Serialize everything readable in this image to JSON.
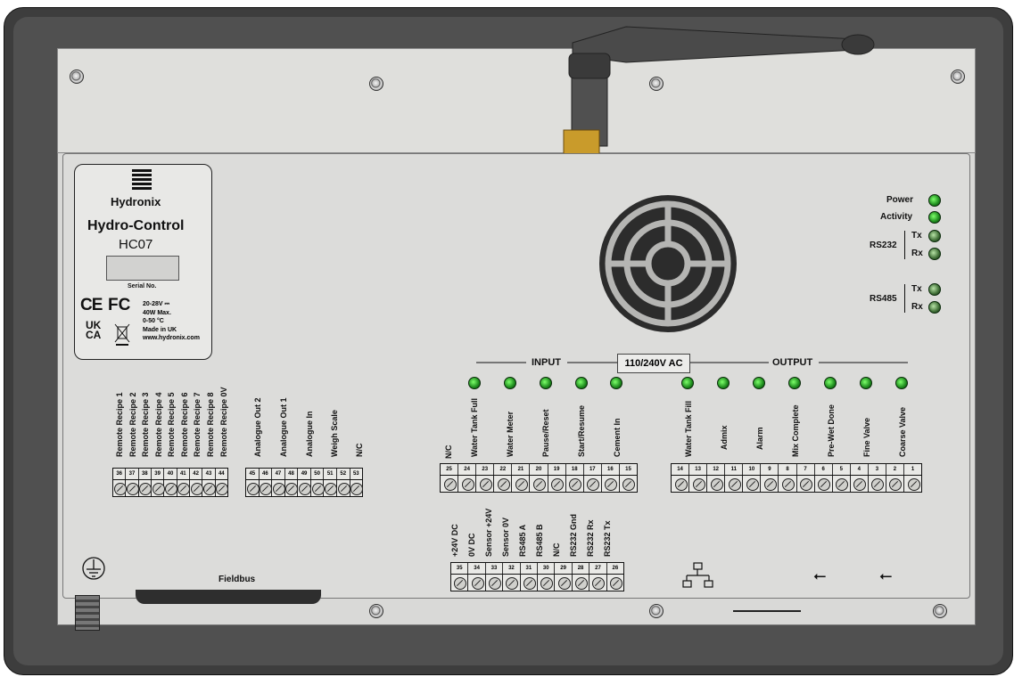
{
  "branding": {
    "logo": "Hydronix",
    "product": "Hydro-Control",
    "model": "HC07",
    "serial_label": "Serial No.",
    "ce": "CE",
    "fc": "FC",
    "uk": "UK",
    "ca": "CA",
    "specs": [
      "20-28V ⎓",
      "40W Max.",
      "0-50 °C",
      "Made in UK",
      "www.hydronix.com"
    ]
  },
  "status_leds": {
    "power": "Power",
    "activity": "Activity",
    "rs232": "RS232",
    "rs485": "RS485",
    "tx": "Tx",
    "rx": "Rx"
  },
  "io_header": {
    "input": "INPUT",
    "voltage": "110/240V AC",
    "output": "OUTPUT"
  },
  "input_labels": [
    "N/C",
    "Water Tank Full",
    "Water Meter",
    "Pause/Reset",
    "Start/Resume",
    "Cement In"
  ],
  "input_numbers": [
    "25",
    "24",
    "23",
    "22",
    "21",
    "20",
    "19",
    "18",
    "17",
    "16",
    "15"
  ],
  "output_labels": [
    "Water Tank Fill",
    "Admix",
    "Alarm",
    "Mix Complete",
    "Pre-Wet Done",
    "Fine Valve",
    "Coarse Valve"
  ],
  "output_numbers": [
    "14",
    "13",
    "12",
    "11",
    "10",
    "9",
    "8",
    "7",
    "6",
    "5",
    "4",
    "3",
    "2",
    "1"
  ],
  "recipe_labels": [
    "Remote Recipe 1",
    "Remote Recipe 2",
    "Remote Recipe 3",
    "Remote Recipe 4",
    "Remote Recipe 5",
    "Remote Recipe 6",
    "Remote Recipe 7",
    "Remote Recipe 8",
    "Remote Recipe 0V"
  ],
  "recipe_numbers": [
    "36",
    "37",
    "38",
    "39",
    "40",
    "41",
    "42",
    "43",
    "44"
  ],
  "analogue_labels": [
    "Analogue Out 2",
    "Analogue Out 1",
    "Analogue In",
    "Weigh Scale",
    "N/C"
  ],
  "analogue_numbers": [
    "45",
    "46",
    "47",
    "48",
    "49",
    "50",
    "51",
    "52",
    "53"
  ],
  "comm_labels": [
    "+24V DC",
    "0V DC",
    "Sensor +24V",
    "Sensor 0V",
    "RS485 A",
    "RS485 B",
    "N/C",
    "RS232 Gnd",
    "RS232 Rx",
    "RS232 Tx"
  ],
  "comm_numbers": [
    "35",
    "34",
    "33",
    "32",
    "31",
    "30",
    "29",
    "28",
    "27",
    "26"
  ],
  "fieldbus": "Fieldbus",
  "polarity": {
    "plus": "+",
    "minus": "-"
  },
  "icons": [
    "antenna-icon",
    "earth-ground-icon",
    "network-icon",
    "usb-icon",
    "led-indicator-icon",
    "screw-icon"
  ],
  "colors": {
    "frame": "#3d3d3d",
    "panel": "#d9d9d7",
    "led_on": "#3fcf2e"
  }
}
